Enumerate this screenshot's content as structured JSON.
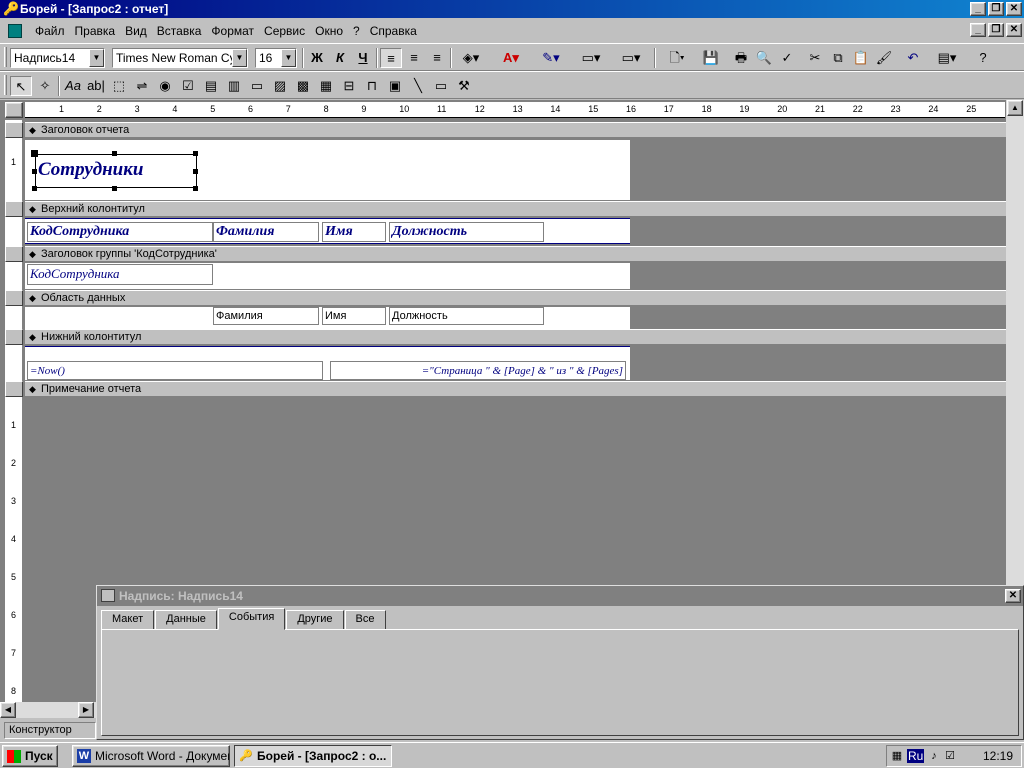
{
  "window": {
    "title": "Борей - [Запрос2 : отчет]",
    "minimize": "_",
    "restore": "❐",
    "close": "✕"
  },
  "menu": [
    "Файл",
    "Правка",
    "Вид",
    "Вставка",
    "Формат",
    "Сервис",
    "Окно",
    "?",
    "Справка"
  ],
  "toolbar": {
    "object_combo": "Надпись14",
    "font_combo": "Times New Roman Cyr",
    "size_combo": "16",
    "bold": "Ж",
    "italic": "К",
    "underline": "Ч"
  },
  "ruler_marks": [
    "1",
    "2",
    "3",
    "4",
    "5",
    "6",
    "7",
    "8",
    "9",
    "10",
    "11",
    "12",
    "13",
    "14",
    "15",
    "16",
    "17",
    "18",
    "19",
    "20",
    "21",
    "22",
    "23",
    "24",
    "25"
  ],
  "vruler_marks": [
    "1",
    "1",
    "2",
    "3",
    "4",
    "5",
    "6",
    "7",
    "8"
  ],
  "sections": {
    "report_header": "Заголовок отчета",
    "page_header": "Верхний колонтитул",
    "group_header": "Заголовок группы 'КодСотрудника'",
    "detail": "Область данных",
    "page_footer": "Нижний колонтитул",
    "report_footer": "Примечание отчета"
  },
  "controls": {
    "title": "Сотрудники",
    "hdr_code": "КодСотрудника",
    "hdr_last": "Фамилия",
    "hdr_first": "Имя",
    "hdr_pos": "Должность",
    "grp_code": "КодСотрудника",
    "fld_last": "Фамилия",
    "fld_first": "Имя",
    "fld_pos": "Должность",
    "now": "=Now()",
    "page": "=\"Страница \" & [Page] & \" из \" & [Pages]"
  },
  "property_sheet": {
    "title": "Надпись: Надпись14",
    "tabs": [
      "Макет",
      "Данные",
      "События",
      "Другие",
      "Все"
    ],
    "active_tab": "События"
  },
  "status": {
    "mode": "Конструктор"
  },
  "taskbar": {
    "start": "Пуск",
    "items": [
      "Microsoft Word - Докумен...",
      "Борей - [Запрос2 : о..."
    ],
    "lang": "Ru",
    "clock": "12:19"
  },
  "colors": {
    "titlebar": "#000080",
    "label_text": "#000080",
    "face": "#c0c0c0"
  }
}
